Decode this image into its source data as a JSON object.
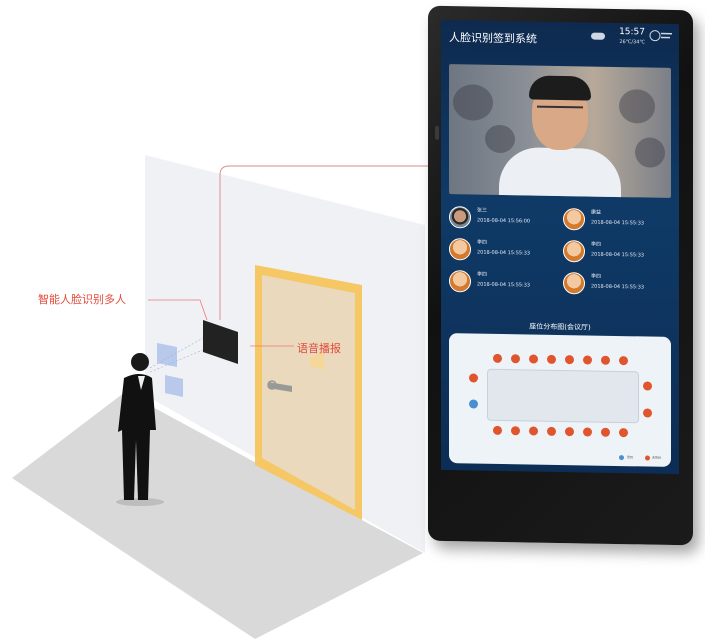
{
  "callouts": {
    "face_recognition": "智能人脸识别多人",
    "voice_broadcast": "语音播报"
  },
  "screen": {
    "title": "人脸识别签到系统",
    "time": "15:57",
    "temperature": "26℃/34℃",
    "records": [
      {
        "name": "张三",
        "time": "2018-08-04 15:56:00",
        "avatar": "photo"
      },
      {
        "name": "康益",
        "time": "2018-08-04 15:55:33",
        "avatar": "cartoon"
      },
      {
        "name": "李四",
        "time": "2018-08-04 15:55:33",
        "avatar": "cartoon"
      },
      {
        "name": "李四",
        "time": "2018-08-04 15:55:33",
        "avatar": "cartoon"
      },
      {
        "name": "李四",
        "time": "2018-08-04 15:55:33",
        "avatar": "cartoon"
      },
      {
        "name": "李四",
        "time": "2018-08-04 15:55:33",
        "avatar": "cartoon"
      }
    ],
    "seat_map_title": "座位分布图(会议厅)",
    "legend_signed": "签到",
    "legend_unsigned": "未签到"
  },
  "colors": {
    "accent_red": "#e24a3b",
    "screen_bg": "#0f3a67",
    "seat_red": "#e0552e",
    "seat_blue": "#4a8fd1",
    "door": "#e8d3b5"
  }
}
